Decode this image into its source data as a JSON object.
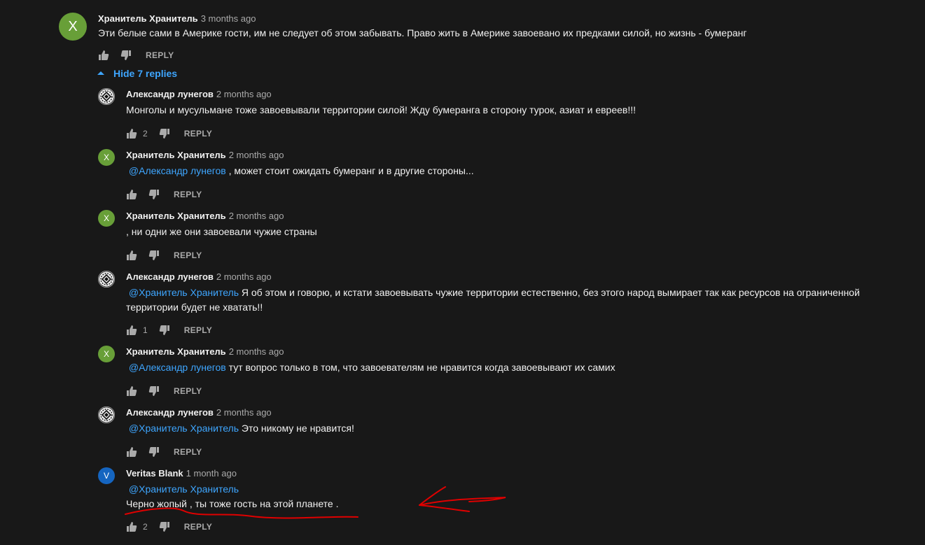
{
  "top_comment": {
    "avatar_letter": "X",
    "author": "Хранитель Хранитель",
    "time": "3 months ago",
    "text": "Эти белые сами в Америке гости, им не следует об этом забывать. Право жить в Америке завоевано  их предками силой, но жизнь - бумеранг",
    "reply_label": "REPLY"
  },
  "replies_toggle": {
    "label": "Hide 7 replies"
  },
  "replies": [
    {
      "author": "Александр лунегов",
      "time": "2 months ago",
      "avatar": "emblem",
      "avatar_letter": "",
      "mention": "",
      "text": "Монголы и мусульмане тоже завоевывали территории силой! Жду бумеранга в сторону турок, азиат и евреев!!!",
      "likes": "2",
      "reply_label": "REPLY"
    },
    {
      "author": "Хранитель Хранитель",
      "time": "2 months ago",
      "avatar": "green",
      "avatar_letter": "X",
      "mention": "@Александр лунегов",
      "text": " , может стоит ожидать бумеранг и в другие стороны...",
      "likes": "",
      "reply_label": "REPLY"
    },
    {
      "author": "Хранитель Хранитель",
      "time": "2 months ago",
      "avatar": "green",
      "avatar_letter": "X",
      "mention": "",
      "text": ", ни одни же они завоевали чужие страны",
      "likes": "",
      "reply_label": "REPLY"
    },
    {
      "author": "Александр лунегов",
      "time": "2 months ago",
      "avatar": "emblem",
      "avatar_letter": "",
      "mention": "@Хранитель Хранитель",
      "text": "  Я об этом и говорю, и кстати завоевывать чужие территории естественно, без этого народ вымирает так как ресурсов на ограниченной территории будет не хватать!!",
      "likes": "1",
      "reply_label": "REPLY"
    },
    {
      "author": "Хранитель Хранитель",
      "time": "2 months ago",
      "avatar": "green",
      "avatar_letter": "X",
      "mention": "@Александр лунегов",
      "text": "  тут вопрос только в том, что завоевателям  не нравится когда завоевывают их самих",
      "likes": "",
      "reply_label": "REPLY"
    },
    {
      "author": "Александр лунегов",
      "time": "2 months ago",
      "avatar": "emblem",
      "avatar_letter": "",
      "mention": "@Хранитель Хранитель",
      "text": "  Это никому не нравится!",
      "likes": "",
      "reply_label": "REPLY"
    },
    {
      "author": "Veritas Blank",
      "time": "1 month ago",
      "avatar": "blue",
      "avatar_letter": "V",
      "mention": "@Хранитель Хранитель",
      "text": "Черно жопый , ты тоже гость на этой планете .",
      "likes": "2",
      "reply_label": "REPLY"
    }
  ],
  "colors": {
    "background": "#181818",
    "link": "#3ea6ff",
    "muted": "#aaaaaa",
    "annotation": "#e00000"
  },
  "icons": {
    "like": "thumb-up-icon",
    "dislike": "thumb-down-icon",
    "toggle": "caret-up-icon"
  }
}
